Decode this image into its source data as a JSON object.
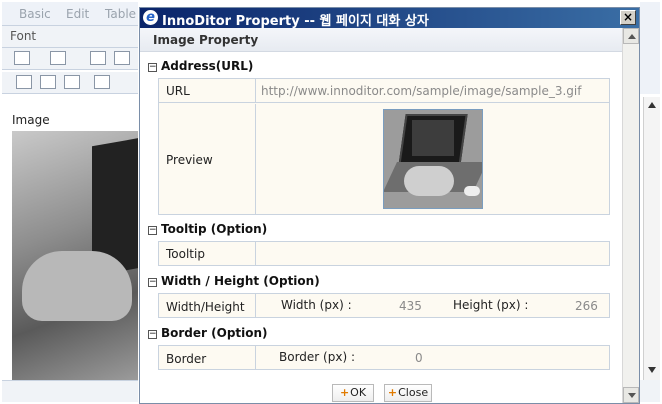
{
  "editor": {
    "menu": [
      "Basic",
      "Edit",
      "Table"
    ],
    "font_label": "Font",
    "image_label": "Image"
  },
  "dialog": {
    "title": "InnoDitor Property -- 웹 페이지 대화 상자",
    "close_label": "×",
    "header": "Image Property",
    "sections": {
      "address": "Address(URL)",
      "tooltip": "Tooltip (Option)",
      "size": "Width / Height (Option)",
      "border": "Border (Option)"
    },
    "url_label": "URL",
    "url_value": "http://www.innoditor.com/sample/image/sample_3.gif",
    "preview_label": "Preview",
    "tooltip_label": "Tooltip",
    "tooltip_value": "",
    "size_label": "Width/Height",
    "width_label": "Width (px) :",
    "width_value": "435",
    "height_label": "Height (px) :",
    "height_value": "266",
    "border_label": "Border",
    "border_px_label": "Border (px) :",
    "border_value": "0",
    "ok_label": "OK",
    "close_button_label": "Close"
  }
}
